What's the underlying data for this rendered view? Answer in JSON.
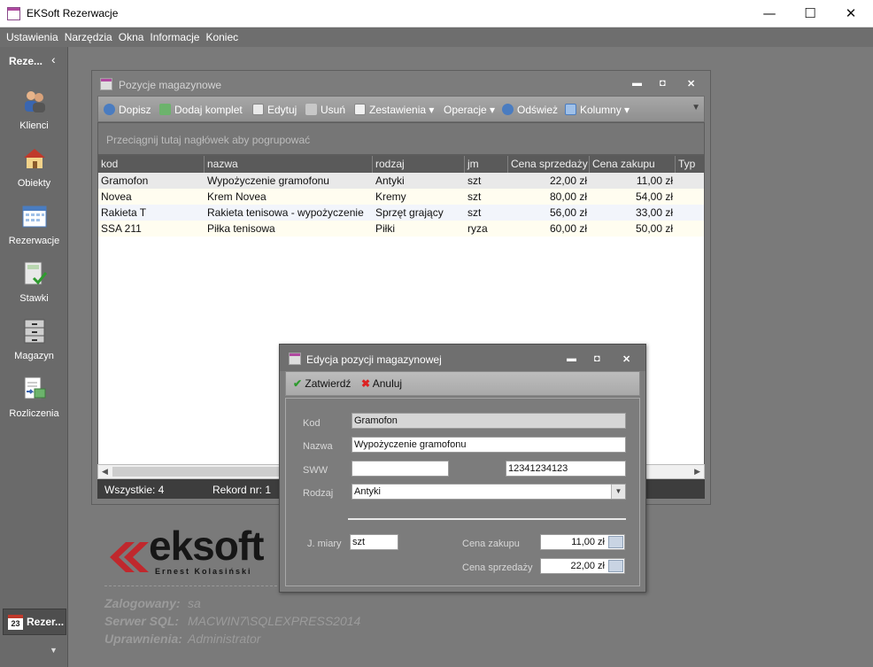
{
  "window": {
    "title": "EKSoft Rezerwacje",
    "min": "—",
    "max": "☐",
    "close": "✕"
  },
  "menu": [
    "Ustawienia",
    "Narzędzia",
    "Okna",
    "Informacje",
    "Koniec"
  ],
  "nav": {
    "header": "Reze...",
    "collapse": "‹",
    "items": [
      {
        "label": "Klienci",
        "icon": "people-icon"
      },
      {
        "label": "Obiekty",
        "icon": "house-icon"
      },
      {
        "label": "Rezerwacje",
        "icon": "calendar-grid-icon"
      },
      {
        "label": "Stawki",
        "icon": "calculator-check-icon"
      },
      {
        "label": "Magazyn",
        "icon": "cabinet-icon"
      },
      {
        "label": "Rozliczenia",
        "icon": "invoice-icon"
      }
    ],
    "bottom": {
      "label": "Rezer...",
      "day": "23"
    },
    "more": "▼"
  },
  "child": {
    "title": "Pozycje magazynowe",
    "controls": {
      "min": "▬",
      "max": "◘",
      "close": "✕"
    },
    "toolbar": {
      "dopisz": "Dopisz",
      "dodaj_komplet": "Dodaj komplet",
      "edytuj": "Edytuj",
      "usun": "Usuń",
      "zestawienia": "Zestawienia",
      "operacje": "Operacje",
      "odswiez": "Odśwież",
      "kolumny": "Kolumny",
      "more": "▼"
    },
    "group_hint": "Przeciągnij tutaj nagłówek aby pogrupować",
    "columns": [
      "kod",
      "nazwa",
      "rodzaj",
      "jm",
      "Cena sprzedaży",
      "Cena zakupu",
      "Typ"
    ],
    "rows": [
      {
        "kod": "Gramofon",
        "nazwa": "Wypożyczenie gramofonu",
        "rodzaj": "Antyki",
        "jm": "szt",
        "sprzedaz": "22,00 zł",
        "zakup": "11,00 zł"
      },
      {
        "kod": "Novea",
        "nazwa": "Krem Novea",
        "rodzaj": "Kremy",
        "jm": "szt",
        "sprzedaz": "80,00 zł",
        "zakup": "54,00 zł"
      },
      {
        "kod": "Rakieta T",
        "nazwa": "Rakieta tenisowa - wypożyczenie",
        "rodzaj": "Sprzęt grający",
        "jm": "szt",
        "sprzedaz": "56,00 zł",
        "zakup": "33,00 zł"
      },
      {
        "kod": "SSA 211",
        "nazwa": "Piłka tenisowa",
        "rodzaj": "Piłki",
        "jm": "ryza",
        "sprzedaz": "60,00 zł",
        "zakup": "50,00 zł"
      }
    ],
    "scroll": {
      "left": "◀",
      "right": "▶"
    },
    "status": {
      "count": "Wszystkie: 4",
      "record": "Rekord nr: 1"
    }
  },
  "brand": {
    "name": "eksoft",
    "sub": "Ernest Kolasiński",
    "colors": {
      "mark": "#c0282d"
    }
  },
  "info": {
    "user_label": "Zalogowany:",
    "user": "sa",
    "server_label": "Serwer SQL:",
    "server": "MACWIN7\\SQLEXPRESS2014",
    "perm_label": "Uprawnienia:",
    "perm": "Administrator"
  },
  "dialog": {
    "title": "Edycja pozycji magazynowej",
    "controls": {
      "min": "▬",
      "max": "◘",
      "close": "✕"
    },
    "confirm": "Zatwierdź",
    "cancel": "Anuluj",
    "fields": {
      "kod_label": "Kod",
      "kod": "Gramofon",
      "nazwa_label": "Nazwa",
      "nazwa": "Wypożyczenie gramofonu",
      "sww_label": "SWW",
      "sww": "",
      "ean": "12341234123",
      "rodzaj_label": "Rodzaj",
      "rodzaj": "Antyki",
      "rodzaj_arrow": "▼",
      "jm_label": "J. miary",
      "jm": "szt",
      "zakup_label": "Cena zakupu",
      "zakup": "11,00 zł",
      "sprzedaz_label": "Cena sprzedaży",
      "sprzedaz": "22,00 zł"
    }
  }
}
